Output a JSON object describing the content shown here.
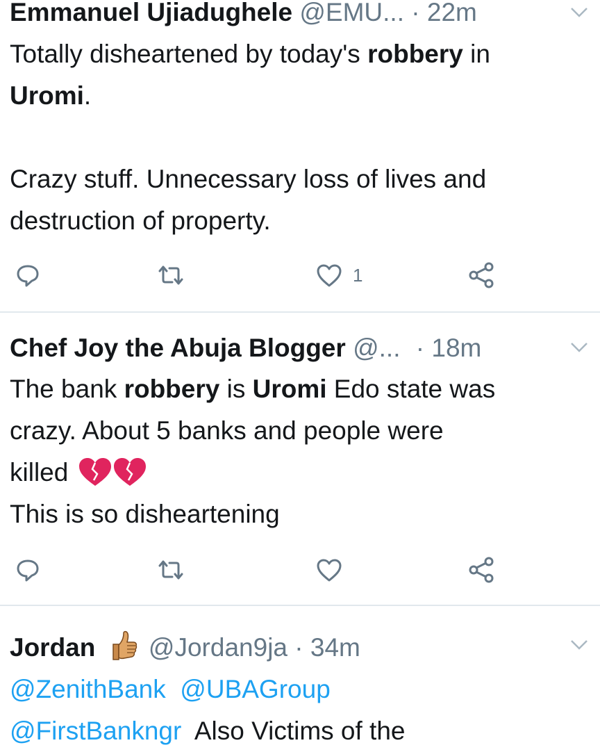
{
  "tweets": [
    {
      "name": "Emmanuel Ujiadughele",
      "handle": "@EMU...",
      "dot": "·",
      "time": "22m",
      "body_lines": [
        [
          "Totally disheartened by today's ",
          "robbery",
          " in"
        ],
        [
          "Uromi",
          "."
        ],
        [
          "Crazy stuff. Unnecessary loss of lives and"
        ],
        [
          "destruction of property."
        ]
      ],
      "like_count": "1"
    },
    {
      "name": "Chef Joy the Abuja Blogger",
      "handle": "@...",
      "dot": "·",
      "time": "18m",
      "body_lines": [
        [
          "The bank ",
          "robbery",
          " is ",
          "Uromi",
          " Edo state was"
        ],
        [
          "crazy. About 5 banks and people were"
        ],
        [
          "killed"
        ],
        [
          "This is so disheartening"
        ]
      ],
      "emoji": "broken-heart-icon x2"
    },
    {
      "name": "Jordan",
      "handle": "@Jordan9ja",
      "dot": "·",
      "time": "34m",
      "mentions": [
        "@ZenithBank",
        "@UBAGroup",
        "@FirstBankngr"
      ],
      "tail_text": "Also Victims of the",
      "emoji": "thumbs-up-icon"
    }
  ],
  "icons": [
    "reply-icon",
    "retweet-icon",
    "like-icon",
    "share-icon",
    "chevron-down-icon"
  ],
  "colors": {
    "text": "#14171a",
    "muted": "#657786",
    "link": "#1da1f2",
    "divider": "#e1e8ed",
    "heart": "#e0245e"
  }
}
